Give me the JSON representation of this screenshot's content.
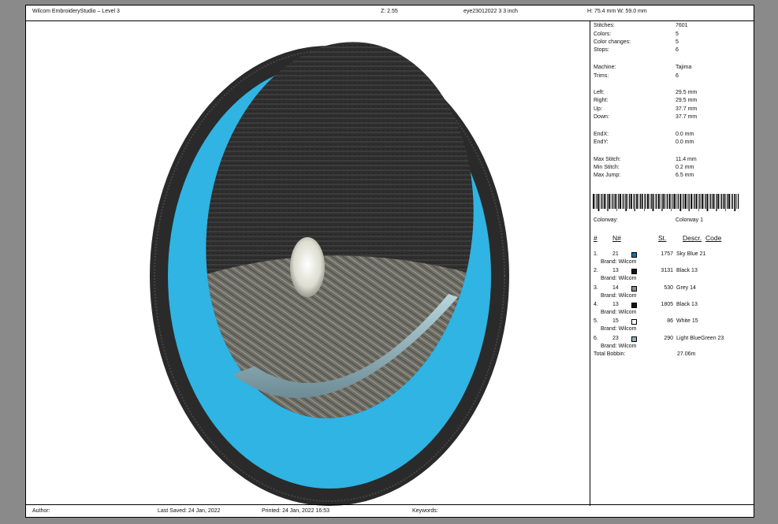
{
  "header": {
    "app_title": "Wilcom EmbroideryStudio – Level 3",
    "zoom": "Z: 2.55",
    "file": "eye23012022 3 3 inch",
    "size": "H: 75.4 mm   W: 59.0 mm"
  },
  "stats": [
    {
      "label": "Stitches:",
      "value": "7601"
    },
    {
      "label": "Colors:",
      "value": "5"
    },
    {
      "label": "Color changes:",
      "value": "5"
    },
    {
      "label": "Stops:",
      "value": "6"
    },
    {
      "label": "Machine:",
      "value": "Tajima"
    },
    {
      "label": "Trims:",
      "value": "6"
    },
    {
      "label": "Left:",
      "value": "29.5 mm"
    },
    {
      "label": "Right:",
      "value": "29.5 mm"
    },
    {
      "label": "Up:",
      "value": "37.7 mm"
    },
    {
      "label": "Down:",
      "value": "37.7 mm"
    },
    {
      "label": "EndX:",
      "value": "0.0 mm"
    },
    {
      "label": "EndY:",
      "value": "0.0 mm"
    },
    {
      "label": "Max Stitch:",
      "value": "11.4 mm"
    },
    {
      "label": "Min Stitch:",
      "value": "0.2 mm"
    },
    {
      "label": "Max Jump:",
      "value": "6.5 mm"
    }
  ],
  "colorway": {
    "label": "Colorway:",
    "value": "Colorway 1"
  },
  "table_headers": {
    "num": "#",
    "n": "N#",
    "st": "St.",
    "descr": "Descr.",
    "code": "Code"
  },
  "colors": [
    {
      "idx": "1.",
      "n": "21",
      "brand": "Brand: Wilcom",
      "swatch": "#1a6fa6",
      "st": "1757",
      "descr": "Sky Blue 21"
    },
    {
      "idx": "2.",
      "n": "13",
      "brand": "Brand: Wilcom",
      "swatch": "#141414",
      "st": "3131",
      "descr": "Black 13"
    },
    {
      "idx": "3.",
      "n": "14",
      "brand": "Brand: Wilcom",
      "swatch": "#8c8c8c",
      "st": "530",
      "descr": "Grey 14"
    },
    {
      "idx": "4.",
      "n": "13",
      "brand": "Brand: Wilcom",
      "swatch": "#141414",
      "st": "1805",
      "descr": "Black 13"
    },
    {
      "idx": "5.",
      "n": "15",
      "brand": "Brand: Wilcom",
      "swatch": "#ffffff",
      "st": "86",
      "descr": "White 15"
    },
    {
      "idx": "6.",
      "n": "23",
      "brand": "Brand: Wilcom",
      "swatch": "#8fb0bb",
      "st": "290",
      "descr": "Light BlueGreen 23"
    }
  ],
  "total_bobbin": {
    "label": "Total Bobbin:",
    "value": "27.06m"
  },
  "footer": {
    "author": "Author:",
    "last_saved": "Last Saved: 24 Jan, 2022",
    "printed": "Printed: 24 Jan, 2022 16:53",
    "keywords": "Keywords:"
  }
}
